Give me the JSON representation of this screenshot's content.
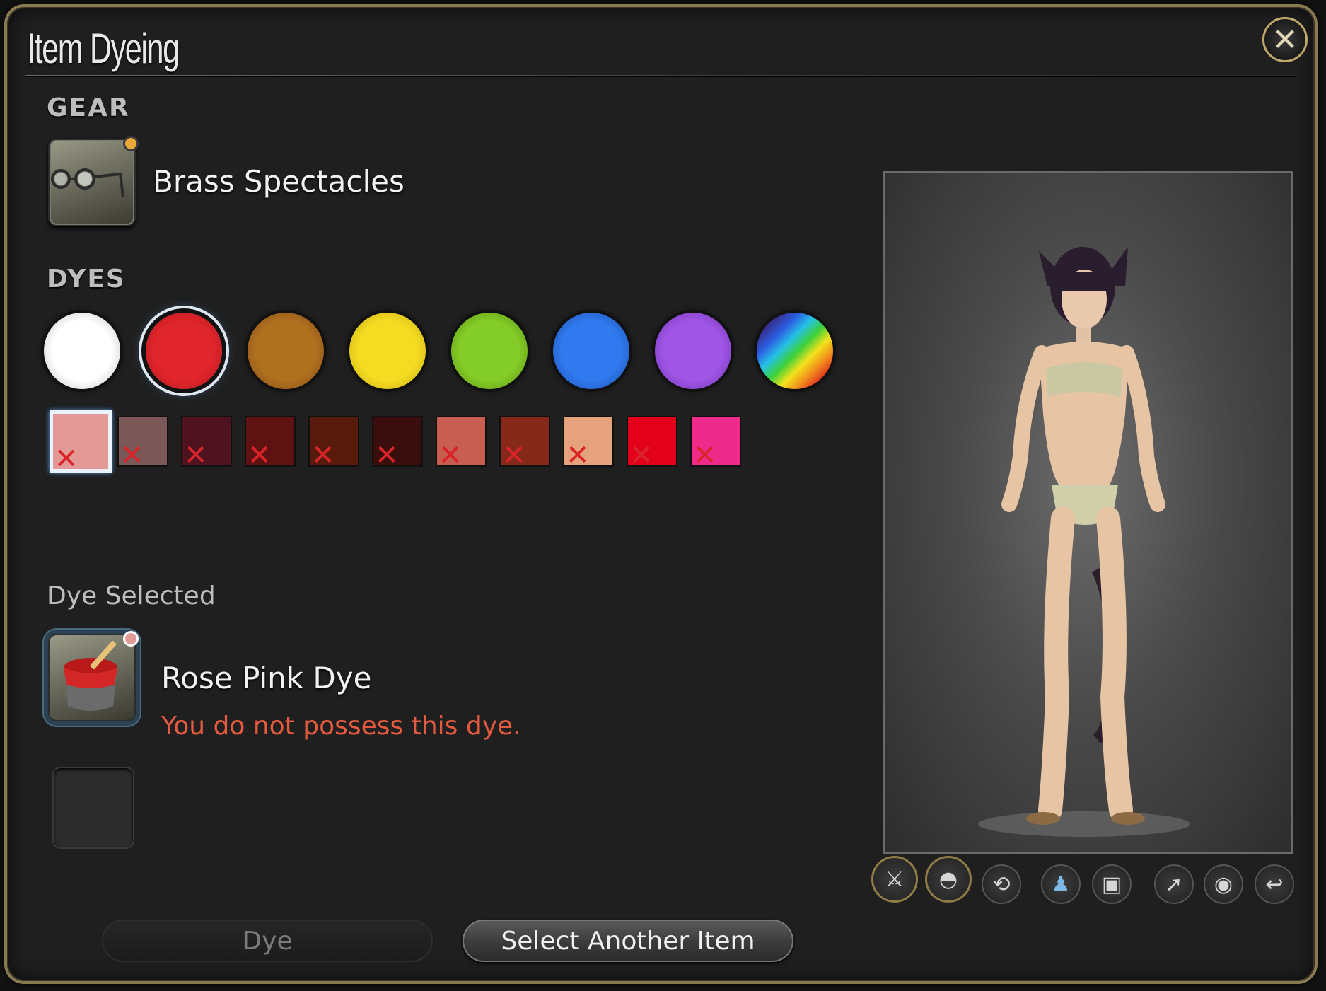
{
  "window": {
    "title": "Item Dyeing"
  },
  "gear": {
    "section_label": "GEAR",
    "item_name": "Brass Spectacles",
    "item_icon": "spectacles-icon"
  },
  "dyes": {
    "section_label": "DYES",
    "categories": [
      {
        "name": "white",
        "color": "#ffffff"
      },
      {
        "name": "red",
        "color": "#d8232a"
      },
      {
        "name": "brown",
        "color": "#a8671f"
      },
      {
        "name": "yellow",
        "color": "#f0d61c"
      },
      {
        "name": "green",
        "color": "#7fc624"
      },
      {
        "name": "blue",
        "color": "#2f74ea"
      },
      {
        "name": "purple",
        "color": "#9a4fe0"
      },
      {
        "name": "rainbow",
        "color": "rainbow"
      }
    ],
    "selected_category": "red",
    "swatches": [
      {
        "color": "#e39a97",
        "owned": false,
        "selected": true
      },
      {
        "color": "#7a5858",
        "owned": false
      },
      {
        "color": "#4f1320",
        "owned": false
      },
      {
        "color": "#5e1212",
        "owned": false
      },
      {
        "color": "#571a0b",
        "owned": false
      },
      {
        "color": "#3b0e0e",
        "owned": false
      },
      {
        "color": "#c85e51",
        "owned": false
      },
      {
        "color": "#86291a",
        "owned": false
      },
      {
        "color": "#e6a27c",
        "owned": false
      },
      {
        "color": "#e3001a",
        "owned": false
      },
      {
        "color": "#ee2a8a",
        "owned": false
      }
    ]
  },
  "dye_selected": {
    "label": "Dye Selected",
    "name": "Rose Pink Dye",
    "warning": "You do not possess this dye.",
    "dot_color": "#e39a97"
  },
  "buttons": {
    "dye": "Dye",
    "select_another": "Select Another Item"
  },
  "preview_controls": [
    "weapon-icon",
    "headgear-icon",
    "rotate-icon",
    "character-icon",
    "dye-pot-icon",
    "pose-icon",
    "eye-icon",
    "reset-icon"
  ]
}
